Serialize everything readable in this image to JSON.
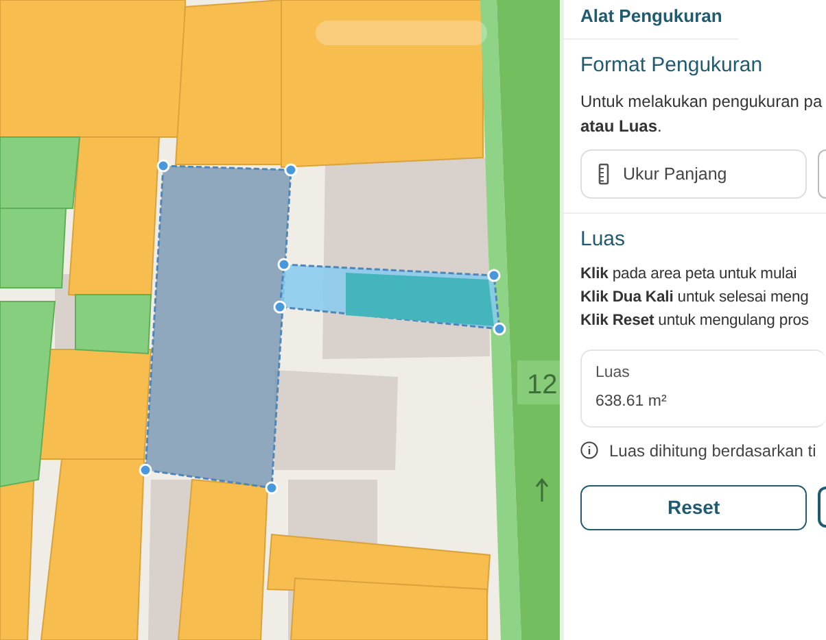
{
  "map": {
    "road_label": "12"
  },
  "panel": {
    "title": "Alat Pengukuran",
    "format": {
      "heading": "Format Pengukuran",
      "description": "Untuk melakukan pengukuran pa\n**atau Luas**.",
      "options": [
        {
          "label": "Ukur Panjang",
          "kind": "length",
          "selected": false
        }
      ]
    },
    "area": {
      "heading": "Luas",
      "instructions": [
        "**Klik** pada area peta untuk mulai",
        "**Klik Dua Kali** untuk selesai meng",
        "**Klik Reset** untuk mengulang pros"
      ],
      "result": {
        "label": "Luas",
        "value": "638.61 m²"
      },
      "note": "Luas dihitung berdasarkan ti",
      "buttons": [
        {
          "label": "Reset",
          "kind": "outline"
        }
      ]
    }
  }
}
